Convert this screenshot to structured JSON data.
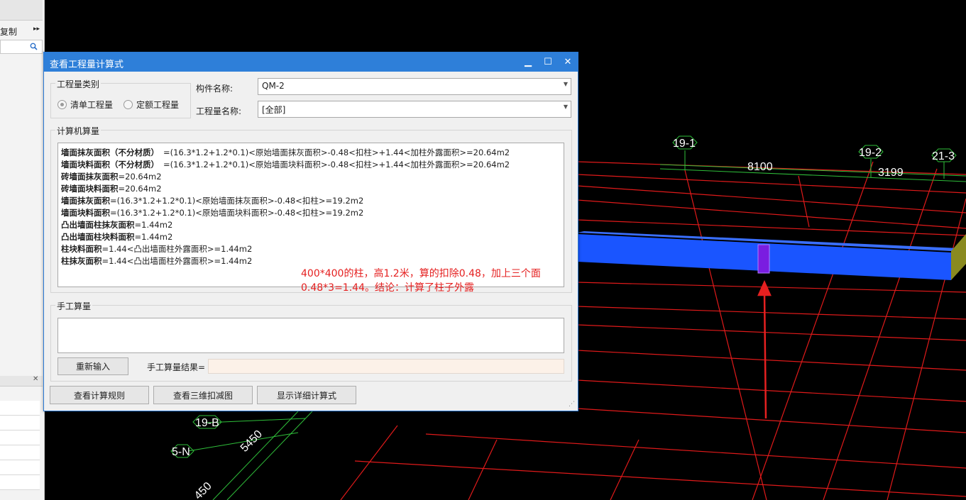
{
  "left_panel": {
    "copy_label": "复制",
    "more_icon": "double-chevron-right-icon",
    "search_icon": "search-icon"
  },
  "cad": {
    "axis_labels": [
      "19-1",
      "19-2",
      "21-3",
      "19-B",
      "5-N"
    ],
    "dim_labels": [
      "8100",
      "3199",
      "5450",
      "450"
    ]
  },
  "dialog": {
    "title": "查看工程量计算式",
    "buttons": {
      "minimize": "▁",
      "maximize": "☐",
      "close": "✕"
    },
    "qty_type_group": "工程量类别",
    "radio_list": "清单工程量",
    "radio_quota": "定额工程量",
    "component_name_label": "构件名称:",
    "component_name_value": "QM-2",
    "qty_name_label": "工程量名称:",
    "qty_name_value": "[全部]",
    "computer_calc_group": "计算机算量",
    "calc_lines": [
      {
        "name": "墙面抹灰面积（不分材质）",
        "formula": "=(16.3*1.2+1.2*0.1)<原始墙面抹灰面积>-0.48<扣柱>+1.44<加柱外露面积>=20.64m2"
      },
      {
        "name": "墙面块料面积（不分材质）",
        "formula": "=(16.3*1.2+1.2*0.1)<原始墙面块料面积>-0.48<扣柱>+1.44<加柱外露面积>=20.64m2"
      },
      {
        "name": "砖墙面抹灰面积",
        "formula": "=20.64m2"
      },
      {
        "name": "砖墙面块料面积",
        "formula": "=20.64m2"
      },
      {
        "name": "墙面抹灰面积",
        "formula": "=(16.3*1.2+1.2*0.1)<原始墙面抹灰面积>-0.48<扣柱>=19.2m2"
      },
      {
        "name": "墙面块料面积",
        "formula": "=(16.3*1.2+1.2*0.1)<原始墙面块料面积>-0.48<扣柱>=19.2m2"
      },
      {
        "name": "凸出墙面柱抹灰面积",
        "formula": "=1.44m2"
      },
      {
        "name": "凸出墙面柱块料面积",
        "formula": "=1.44m2"
      },
      {
        "name": "柱块料面积",
        "formula": "=1.44<凸出墙面柱外露面积>=1.44m2"
      },
      {
        "name": "柱抹灰面积",
        "formula": "=1.44<凸出墙面柱外露面积>=1.44m2"
      }
    ],
    "manual_calc_group": "手工算量",
    "reenter_button": "重新输入",
    "manual_result_label": "手工算量结果=",
    "view_rules_button": "查看计算规则",
    "view_3d_button": "查看三维扣减图",
    "show_detail_button": "显示详细计算式"
  },
  "annotation": {
    "line1": "400*400的柱，高1.2米，算的扣除0.48，加上三个面",
    "line2": "0.48*3=1.44。结论：计算了柱子外露"
  },
  "colors": {
    "grid": "#e01a1a",
    "green": "#2fbf3a",
    "wall": "#1a55ff",
    "column": "#7a1de0",
    "arrow": "#e52020",
    "titlebar": "#2e7fd9"
  }
}
